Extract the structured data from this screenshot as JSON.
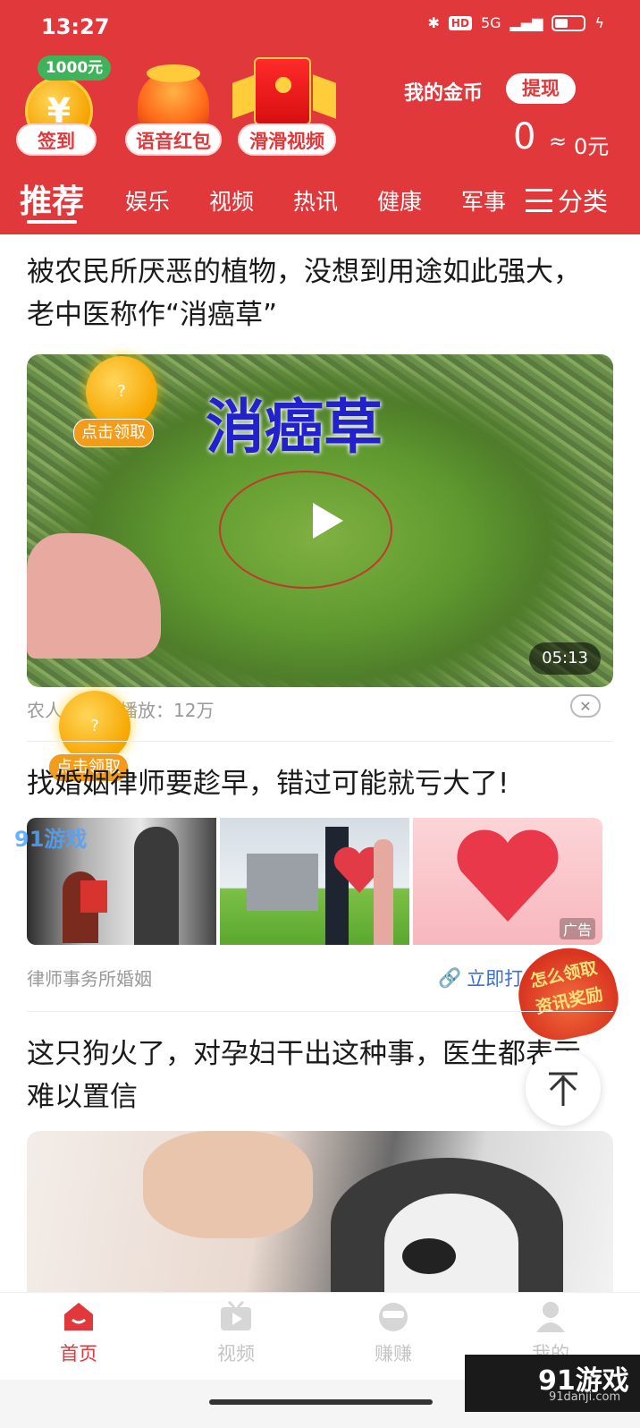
{
  "status_bar": {
    "time": "13:27",
    "network": "5G",
    "hd": "HD"
  },
  "promos": {
    "bonus_tag": "1000元",
    "coin_symbol": "¥",
    "items": [
      {
        "label": "签到",
        "icon": "gold-coin-icon"
      },
      {
        "label": "语音红包",
        "icon": "red-packet-icon"
      },
      {
        "label": "滑滑视频",
        "icon": "red-envelope-icon"
      }
    ]
  },
  "wallet": {
    "label": "我的金币",
    "withdraw": "提现",
    "coins": "0",
    "approx": "≈",
    "yuan": "0元"
  },
  "tabs": [
    {
      "label": "推荐",
      "active": true
    },
    {
      "label": "娱乐"
    },
    {
      "label": "视频"
    },
    {
      "label": "热讯"
    },
    {
      "label": "健康"
    },
    {
      "label": "军事"
    }
  ],
  "category_button": "分类",
  "feed": {
    "article1": {
      "title": "被农民所厌恶的植物，没想到用途如此强大，老中医称作“消癌草”",
      "overlay_text": "消癌草",
      "duration": "05:13",
      "source_partial": "农人",
      "plays": "播放：12万"
    },
    "article2": {
      "title": "找婚姻律师要趁早，错过可能就亏大了!",
      "ad_tag": "广告",
      "source": "律师事务所婚姻",
      "action": "立即打"
    },
    "article3": {
      "title": "这只狗火了，对孕妇干出这种事，医生都表示难以置信"
    }
  },
  "floating": {
    "coin_label": "?",
    "claim": "点击领取",
    "sticker": "怎么领取\n资讯奖励"
  },
  "watermark": {
    "logo": "91游戏",
    "site": "91danji.com"
  },
  "bottom_nav": [
    {
      "label": "首页",
      "active": true
    },
    {
      "label": "视频"
    },
    {
      "label": "赚赚"
    },
    {
      "label": "我的"
    }
  ],
  "colors": {
    "brand": "#e0383b",
    "coin": "#f7a600",
    "link": "#3a6fd8"
  }
}
